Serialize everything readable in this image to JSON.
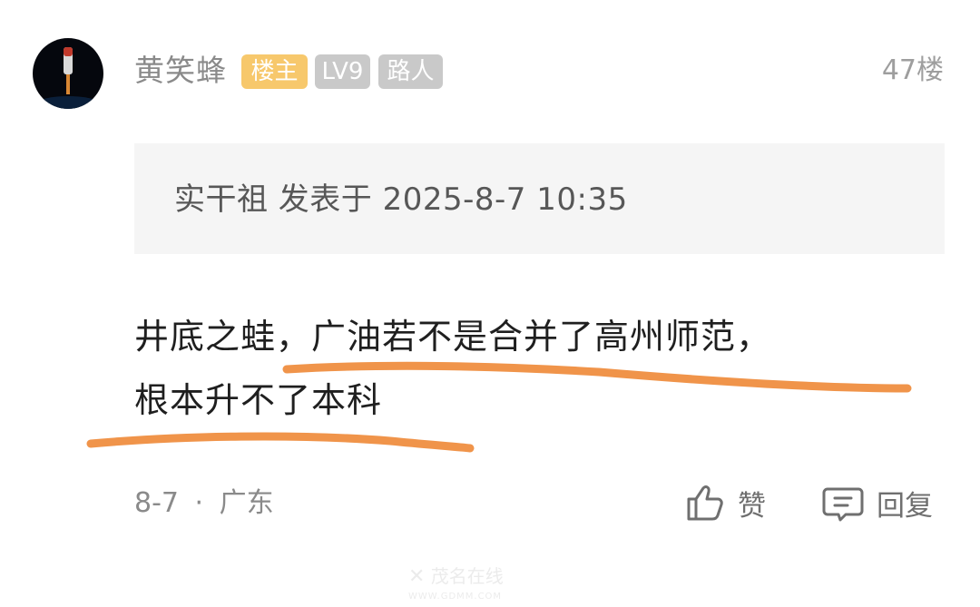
{
  "post": {
    "username": "黄笑蜂",
    "badges": {
      "host": "楼主",
      "level": "LV9",
      "role": "路人"
    },
    "floor": "47楼",
    "quote": {
      "text": "实干祖 发表于 2025-8-7 10:35"
    },
    "content": {
      "line1": "井底之蛙，广油若不是合并了高州师范，",
      "line2": "根本升不了本科"
    },
    "meta": {
      "date": "8-7",
      "separator": "·",
      "location": "广东"
    },
    "actions": {
      "like_label": "赞",
      "reply_label": "回复"
    },
    "watermark": {
      "text": "茂名在线",
      "sub": "WWW.GDMM.COM"
    }
  },
  "colors": {
    "highlight": "#f0944a",
    "badge_host": "#f7c86c",
    "badge_gray": "#c9c9c9",
    "quote_bg": "#f5f5f5"
  },
  "icons": [
    "avatar-image",
    "thumbs-up-icon",
    "comment-icon",
    "site-logo-icon"
  ]
}
